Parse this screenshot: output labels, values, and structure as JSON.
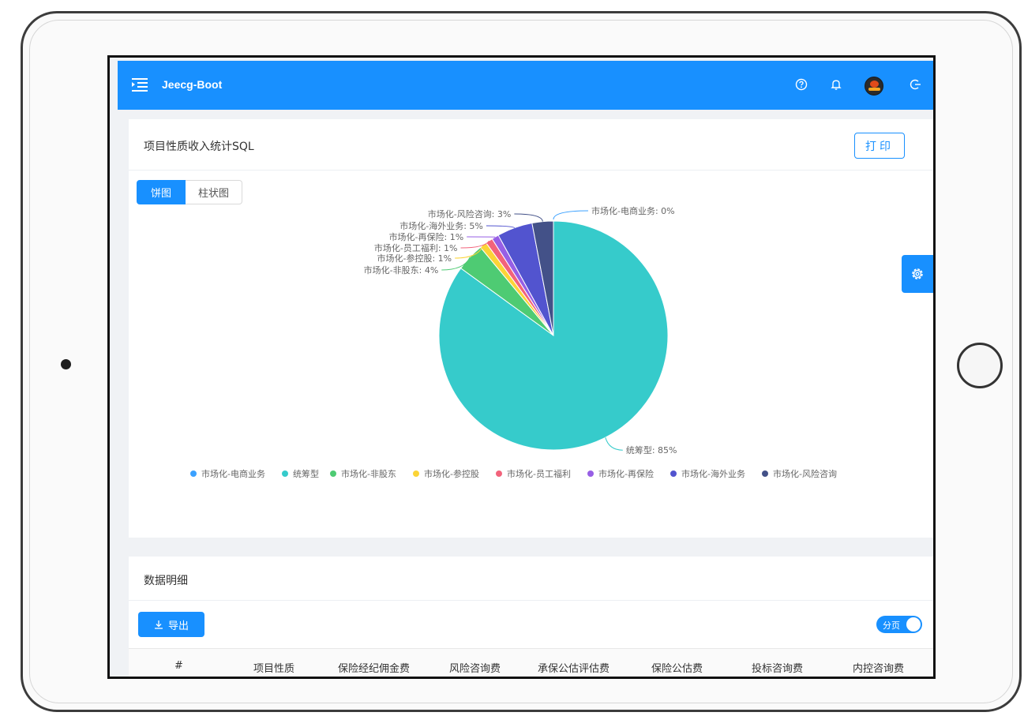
{
  "header": {
    "app_title": "Jeecg-Boot",
    "icons": [
      "menu-unfold-icon",
      "question-circle-icon",
      "bell-icon",
      "avatar",
      "logout-icon"
    ]
  },
  "report": {
    "title": "项目性质收入统计SQL",
    "print_label": "打印",
    "tabs": [
      {
        "label": "饼图",
        "active": true
      },
      {
        "label": "柱状图",
        "active": false
      }
    ]
  },
  "chart_data": {
    "type": "pie",
    "slices": [
      {
        "name": "市场化-电商业务",
        "value": 0,
        "label": "市场化-电商业务: 0%",
        "color": "#3ba1ff"
      },
      {
        "name": "统筹型",
        "value": 85,
        "label": "统筹型: 85%",
        "color": "#36cbcb"
      },
      {
        "name": "市场化-非股东",
        "value": 4,
        "label": "市场化-非股东: 4%",
        "color": "#4ecb73"
      },
      {
        "name": "市场化-参控股",
        "value": 1,
        "label": "市场化-参控股: 1%",
        "color": "#fbd437"
      },
      {
        "name": "市场化-员工福利",
        "value": 1,
        "label": "市场化-员工福利: 1%",
        "color": "#f2637b"
      },
      {
        "name": "市场化-再保险",
        "value": 1,
        "label": "市场化-再保险: 1%",
        "color": "#975fe5"
      },
      {
        "name": "市场化-海外业务",
        "value": 5,
        "label": "市场化-海外业务: 5%",
        "color": "#5254cf"
      },
      {
        "name": "市场化-风险咨询",
        "value": 3,
        "label": "市场化-风险咨询: 3%",
        "color": "#435188"
      }
    ],
    "legend_position": "bottom"
  },
  "details": {
    "title": "数据明细",
    "export_label": "导出",
    "pagination_toggle_label": "分页",
    "pagination_on": true,
    "columns": [
      "#",
      "项目性质",
      "保险经纪佣金费",
      "风险咨询费",
      "承保公估评估费",
      "保险公估费",
      "投标咨询费",
      "内控咨询费"
    ]
  },
  "colors": {
    "primary": "#1890ff",
    "background": "#f0f2f5"
  }
}
